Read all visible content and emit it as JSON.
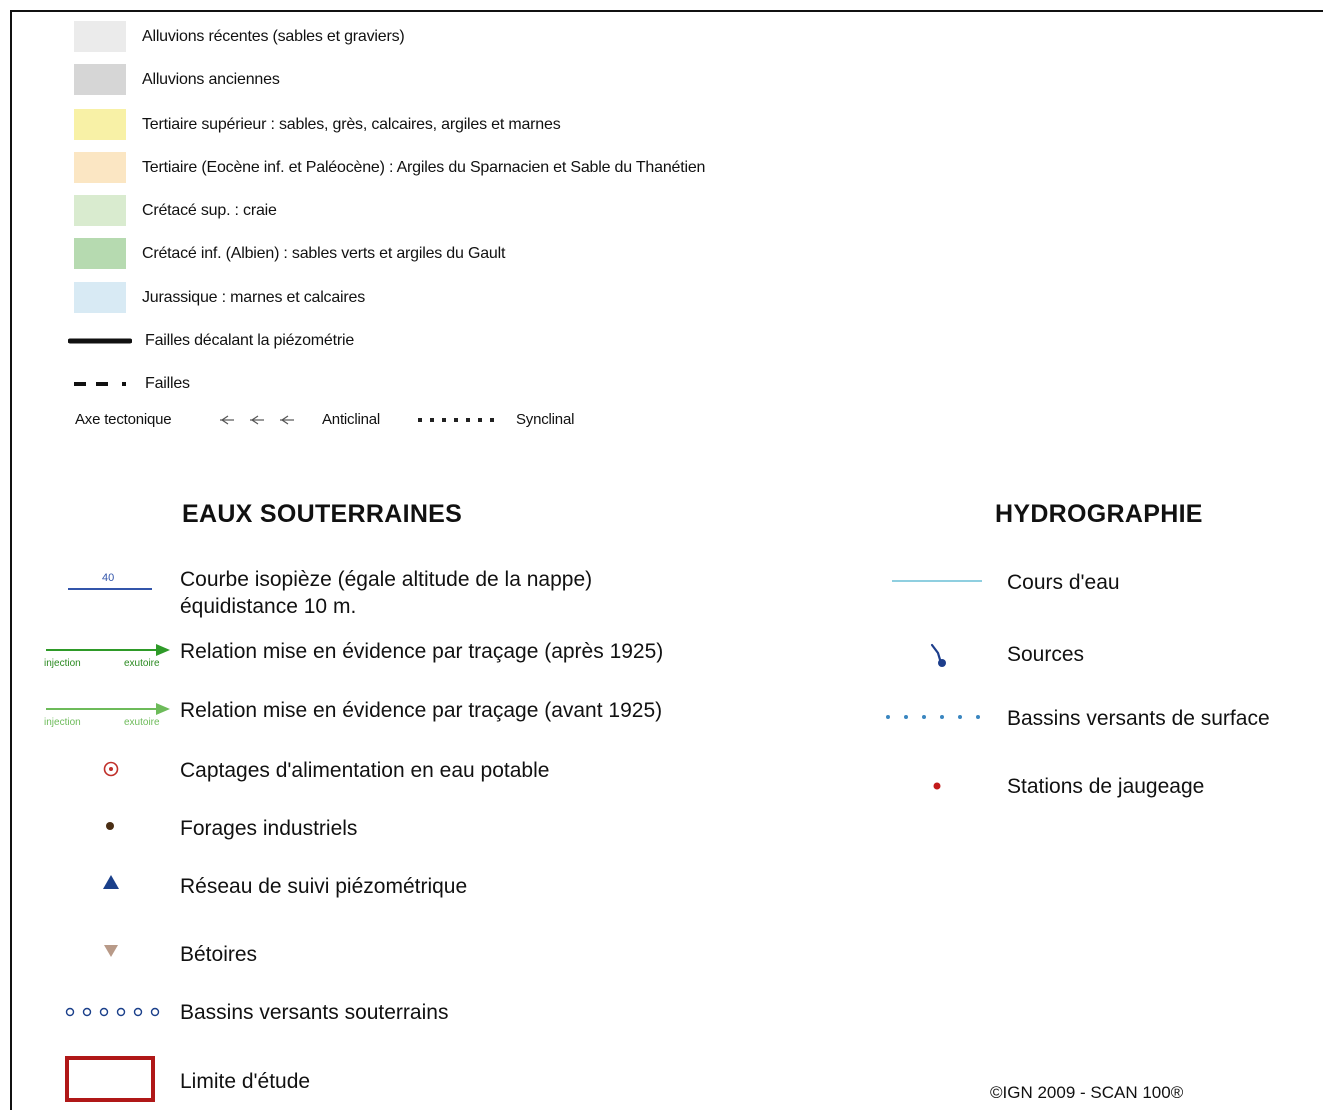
{
  "geology": [
    {
      "label": "Alluvions récentes (sables et graviers)",
      "color": "#ebebeb"
    },
    {
      "label": "Alluvions anciennes",
      "color": "#d6d6d6"
    },
    {
      "label": "Tertiaire supérieur : sables, grès, calcaires, argiles et marnes",
      "color": "#f8f1a6"
    },
    {
      "label": "Tertiaire (Eocène inf. et Paléocène) : Argiles du Sparnacien et Sable du Thanétien",
      "color": "#fbe6c3"
    },
    {
      "label": "Crétacé sup. : craie",
      "color": "#d9ebcf"
    },
    {
      "label": "Crétacé inf. (Albien) : sables verts et argiles du Gault",
      "color": "#b6dab0"
    },
    {
      "label": "Jurassique : marnes et calcaires",
      "color": "#d8eaf4"
    }
  ],
  "faults": [
    {
      "label": "Failles décalant la piézométrie"
    },
    {
      "label": "Failles"
    }
  ],
  "tectonic": {
    "axis_label": "Axe tectonique",
    "anticline": "Anticlinal",
    "syncline": "Synclinal"
  },
  "groundwater": {
    "title": "EAUX SOUTERRAINES",
    "isopiezo_value": "40",
    "isopiezo_label_1": "Courbe isopièze (égale altitude de la nappe)",
    "isopiezo_label_2": "équidistance 10 m.",
    "tracing_after": "Relation mise en évidence par traçage (après 1925)",
    "tracing_before": "Relation mise en évidence par traçage (avant 1925)",
    "injection": "injection",
    "exutoire": "exutoire",
    "captages": "Captages d'alimentation en eau potable",
    "forages": "Forages industriels",
    "reseau": "Réseau de suivi piézométrique",
    "betoires": "Bétoires",
    "bassins_sout": "Bassins versants souterrains",
    "limite": "Limite d'étude"
  },
  "hydrography": {
    "title": "HYDROGRAPHIE",
    "cours": "Cours d'eau",
    "sources": "Sources",
    "bassins_surf": "Bassins versants de surface",
    "stations": "Stations de jaugeage"
  },
  "credit": "©IGN 2009 - SCAN 100®",
  "colors": {
    "isopiezo": "#3355aa",
    "tracing": "#2e9a28",
    "captage": "#c0302a",
    "forage": "#4a2e14",
    "reseau": "#1a3f8a",
    "betoire": "#b89a88",
    "river": "#8fcfe0",
    "source": "#1d3e8c",
    "basin_surface": "#3a86c0",
    "station": "#c21a1a",
    "limite": "#b01818"
  }
}
